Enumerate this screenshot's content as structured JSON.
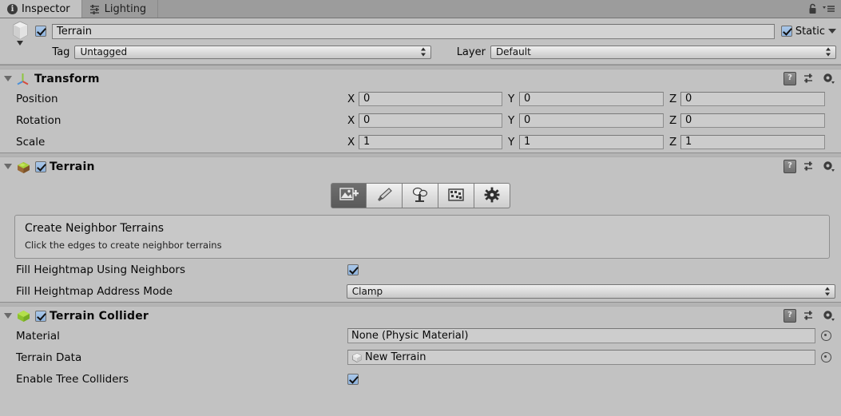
{
  "window": {
    "tabs": [
      {
        "label": "Inspector",
        "icon": "info-icon",
        "active": true
      },
      {
        "label": "Lighting",
        "icon": "sliders-icon",
        "active": false
      }
    ],
    "lock_icon": "lock-icon",
    "menu_icon": "hamburger-menu-icon"
  },
  "gameobject": {
    "icon": "cube-icon",
    "enabled_checkbox": true,
    "name": "Terrain",
    "static_label": "Static",
    "static_checked": true,
    "tag_label": "Tag",
    "tag_value": "Untagged",
    "layer_label": "Layer",
    "layer_value": "Default"
  },
  "components": [
    {
      "id": "transform",
      "title": "Transform",
      "icon": "transform-axis-icon",
      "has_enable_checkbox": false,
      "rows": [
        {
          "label": "Position",
          "x": "0",
          "y": "0",
          "z": "0"
        },
        {
          "label": "Rotation",
          "x": "0",
          "y": "0",
          "z": "0"
        },
        {
          "label": "Scale",
          "x": "1",
          "y": "1",
          "z": "1"
        }
      ],
      "axis_labels": [
        "X",
        "Y",
        "Z"
      ]
    },
    {
      "id": "terrain",
      "title": "Terrain",
      "icon": "terrain-icon",
      "has_enable_checkbox": true,
      "enabled": true,
      "toolbar": [
        {
          "name": "create-neighbor-terrains-tool",
          "icon": "terrain-plus-icon",
          "selected": true
        },
        {
          "name": "paint-terrain-tool",
          "icon": "brush-icon",
          "selected": false
        },
        {
          "name": "paint-trees-tool",
          "icon": "tree-icon",
          "selected": false
        },
        {
          "name": "paint-details-tool",
          "icon": "grass-icon",
          "selected": false
        },
        {
          "name": "terrain-settings-tool",
          "icon": "gear-icon",
          "selected": false
        }
      ],
      "helpbox": {
        "title": "Create Neighbor Terrains",
        "subtitle": "Click the edges to create neighbor terrains"
      },
      "fields": [
        {
          "label": "Fill Heightmap Using Neighbors",
          "type": "checkbox",
          "value": true
        },
        {
          "label": "Fill Heightmap Address Mode",
          "type": "popup",
          "value": "Clamp"
        }
      ]
    },
    {
      "id": "terrain-collider",
      "title": "Terrain Collider",
      "icon": "collider-box-icon",
      "has_enable_checkbox": true,
      "enabled": true,
      "fields": [
        {
          "label": "Material",
          "type": "object",
          "value": "None (Physic Material)",
          "icon": null
        },
        {
          "label": "Terrain Data",
          "type": "object",
          "value": "New Terrain",
          "icon": "terrain-asset-icon"
        },
        {
          "label": "Enable Tree Colliders",
          "type": "checkbox",
          "value": true
        }
      ]
    }
  ],
  "header_icons": {
    "help": "help-icon",
    "preset": "preset-icon",
    "settings": "gear-dropdown-icon"
  },
  "colors": {
    "background": "#c2c2c2",
    "tab_inactive": "#9c9c9c",
    "checkbox_on": "#8fb3dd",
    "terrain_green": "#9ccc3a",
    "terrain_brown": "#9a6a38"
  }
}
